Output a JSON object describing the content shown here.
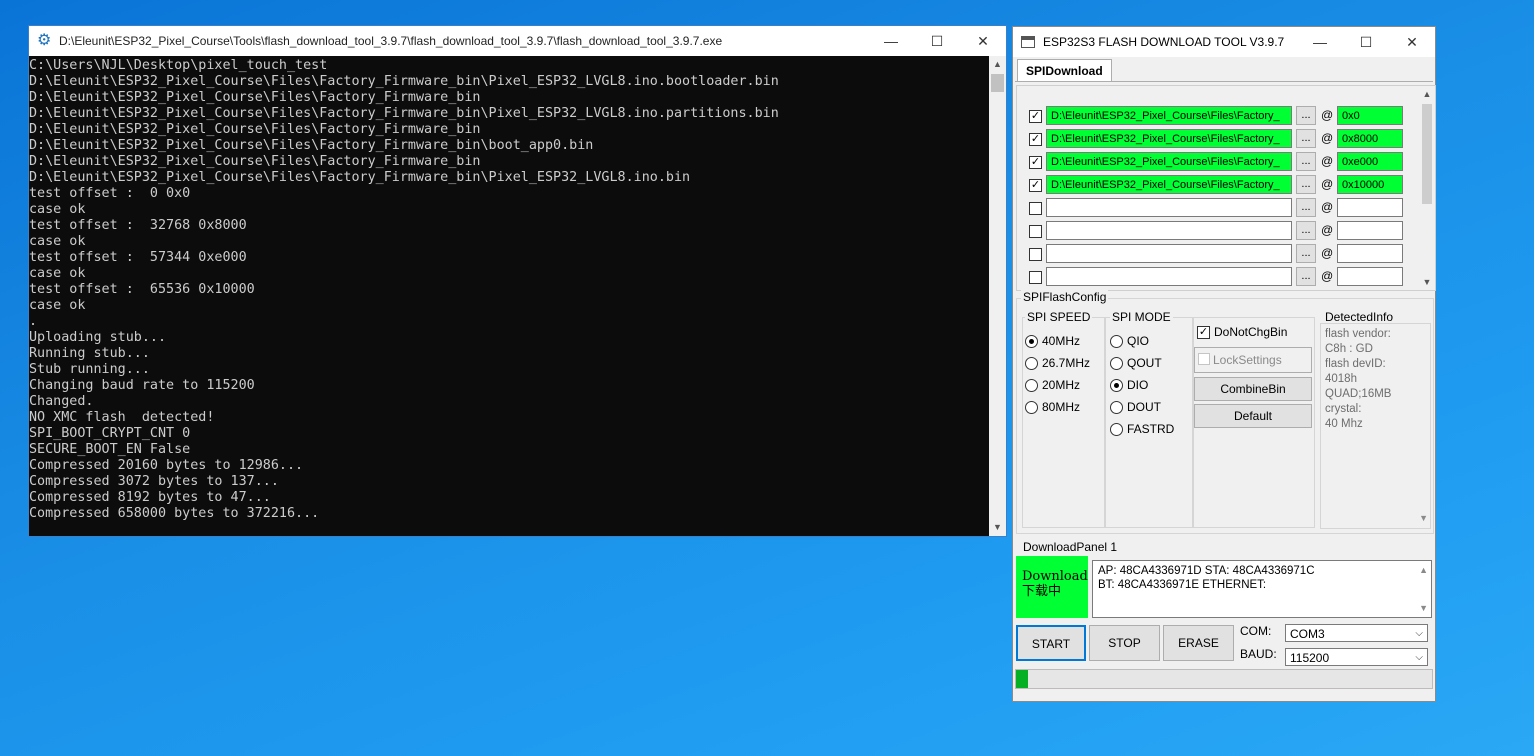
{
  "console": {
    "title": "D:\\Eleunit\\ESP32_Pixel_Course\\Tools\\flash_download_tool_3.9.7\\flash_download_tool_3.9.7\\flash_download_tool_3.9.7.exe",
    "lines": [
      "C:\\Users\\NJL\\Desktop\\pixel_touch_test",
      "D:\\Eleunit\\ESP32_Pixel_Course\\Files\\Factory_Firmware_bin\\Pixel_ESP32_LVGL8.ino.bootloader.bin",
      "D:\\Eleunit\\ESP32_Pixel_Course\\Files\\Factory_Firmware_bin",
      "D:\\Eleunit\\ESP32_Pixel_Course\\Files\\Factory_Firmware_bin\\Pixel_ESP32_LVGL8.ino.partitions.bin",
      "D:\\Eleunit\\ESP32_Pixel_Course\\Files\\Factory_Firmware_bin",
      "D:\\Eleunit\\ESP32_Pixel_Course\\Files\\Factory_Firmware_bin\\boot_app0.bin",
      "D:\\Eleunit\\ESP32_Pixel_Course\\Files\\Factory_Firmware_bin",
      "D:\\Eleunit\\ESP32_Pixel_Course\\Files\\Factory_Firmware_bin\\Pixel_ESP32_LVGL8.ino.bin",
      "test offset :  0 0x0",
      "case ok",
      "test offset :  32768 0x8000",
      "case ok",
      "test offset :  57344 0xe000",
      "case ok",
      "test offset :  65536 0x10000",
      "case ok",
      ".",
      "Uploading stub...",
      "Running stub...",
      "Stub running...",
      "Changing baud rate to 115200",
      "Changed.",
      "NO XMC flash  detected!",
      "SPI_BOOT_CRYPT_CNT 0",
      "SECURE_BOOT_EN False",
      "Compressed 20160 bytes to 12986...",
      "Compressed 3072 bytes to 137...",
      "Compressed 8192 bytes to 47...",
      "Compressed 658000 bytes to 372216..."
    ]
  },
  "tool": {
    "title": "ESP32S3 FLASH DOWNLOAD TOOL V3.9.7",
    "tab": "SPIDownload",
    "files": [
      {
        "checked": true,
        "path": "D:\\Eleunit\\ESP32_Pixel_Course\\Files\\Factory_",
        "offset": "0x0"
      },
      {
        "checked": true,
        "path": "D:\\Eleunit\\ESP32_Pixel_Course\\Files\\Factory_",
        "offset": "0x8000"
      },
      {
        "checked": true,
        "path": "D:\\Eleunit\\ESP32_Pixel_Course\\Files\\Factory_",
        "offset": "0xe000"
      },
      {
        "checked": true,
        "path": "D:\\Eleunit\\ESP32_Pixel_Course\\Files\\Factory_",
        "offset": "0x10000"
      },
      {
        "checked": false,
        "path": "",
        "offset": ""
      },
      {
        "checked": false,
        "path": "",
        "offset": ""
      },
      {
        "checked": false,
        "path": "",
        "offset": ""
      },
      {
        "checked": false,
        "path": "",
        "offset": ""
      }
    ],
    "browse_label": "...",
    "at_label": "@",
    "config": {
      "group_title": "SPIFlashConfig",
      "speed_title": "SPI SPEED",
      "speeds": [
        "40MHz",
        "26.7MHz",
        "20MHz",
        "80MHz"
      ],
      "speed_selected": "40MHz",
      "mode_title": "SPI MODE",
      "modes": [
        "QIO",
        "QOUT",
        "DIO",
        "DOUT",
        "FASTRD"
      ],
      "mode_selected": "DIO",
      "donotchgbin": "DoNotChgBin",
      "locksettings": "LockSettings",
      "combinebin": "CombineBin",
      "default": "Default",
      "detected_title": "DetectedInfo",
      "detected_lines": [
        "flash vendor:",
        "C8h : GD",
        "flash devID:",
        "4018h",
        "QUAD;16MB",
        "crystal:",
        "40 Mhz"
      ]
    },
    "download_panel": {
      "title": "DownloadPanel 1",
      "status_line1": "Download",
      "status_line2": "下载中",
      "log_line1": "AP:  48CA4336971D  STA:  48CA4336971C",
      "log_line2": "BT:  48CA4336971E  ETHERNET:",
      "start": "START",
      "stop": "STOP",
      "erase": "ERASE",
      "com_label": "COM:",
      "com_value": "COM3",
      "baud_label": "BAUD:",
      "baud_value": "115200",
      "progress": 0.03
    }
  }
}
